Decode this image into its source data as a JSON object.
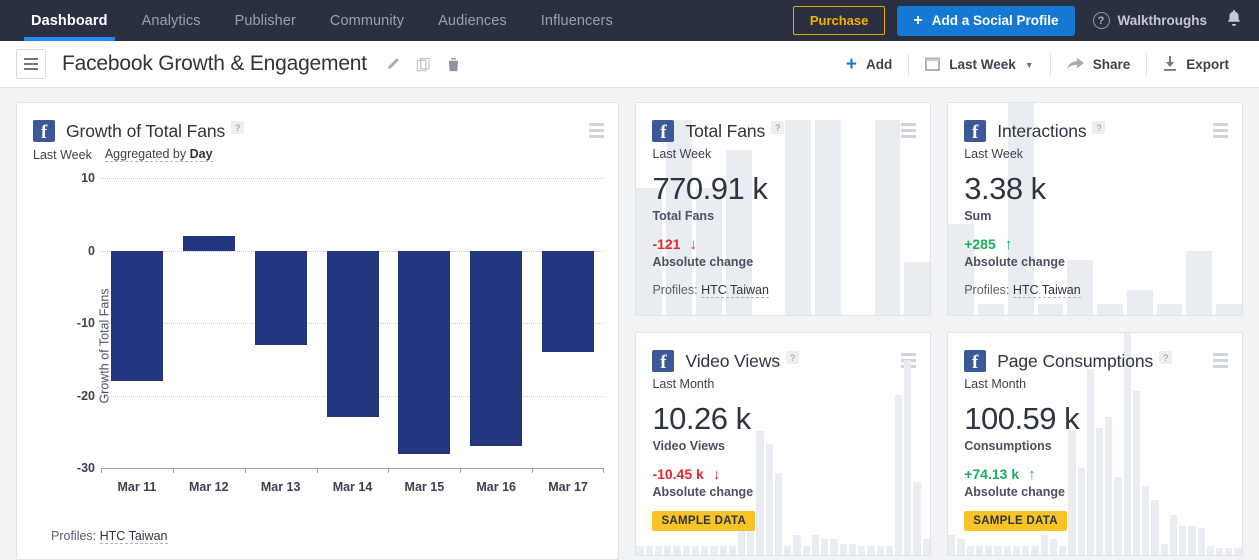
{
  "topnav": {
    "items": [
      {
        "label": "Dashboard",
        "active": true
      },
      {
        "label": "Analytics",
        "active": false
      },
      {
        "label": "Publisher",
        "active": false
      },
      {
        "label": "Community",
        "active": false
      },
      {
        "label": "Audiences",
        "active": false
      },
      {
        "label": "Influencers",
        "active": false
      }
    ],
    "purchase_label": "Purchase",
    "add_profile_label": "Add a Social Profile",
    "add_profile_plus": "+",
    "walkthroughs_label": "Walkthroughs",
    "help_glyph": "?",
    "bell_glyph": "▲",
    "bg_color": "#2b3040",
    "accent_blue": "#1578d3",
    "accent_yellow": "#f5b301"
  },
  "toolbar": {
    "dashboard_title": "Facebook Growth & Engagement",
    "edit_icon": "pencil-icon",
    "copy_icon": "copy-icon",
    "delete_icon": "trash-icon",
    "add_label": "Add",
    "add_plus": "+",
    "date_range_label": "Last Week",
    "share_label": "Share",
    "export_label": "Export"
  },
  "main_chart_card": {
    "title": "Growth of Total Fans",
    "help": "?",
    "period": "Last Week",
    "aggregated_prefix": "Aggregated by ",
    "aggregated_value": "Day",
    "profiles_prefix": "Profiles: ",
    "profiles_value": "HTC Taiwan"
  },
  "chart_data": {
    "type": "bar",
    "title": "Growth of Total Fans",
    "xlabel": "",
    "ylabel": "Growth of Total Fans",
    "categories": [
      "Mar 11",
      "Mar 12",
      "Mar 13",
      "Mar 14",
      "Mar 15",
      "Mar 16",
      "Mar 17"
    ],
    "values": [
      -18,
      2,
      -13,
      -23,
      -28,
      -27,
      -14
    ],
    "ylim": [
      -30,
      10
    ],
    "yticks": [
      10,
      0,
      -10,
      -20,
      -30
    ],
    "grid": true,
    "legend": false,
    "bar_color": "#22357f",
    "aggregation": "Day",
    "period": "Last Week",
    "profiles": "HTC Taiwan"
  },
  "kpi_cards": [
    {
      "title": "Total Fans",
      "help": "?",
      "period": "Last Week",
      "value": "770.91 k",
      "metric_label": "Total Fans",
      "change": "-121",
      "change_arrow": "↓",
      "change_color": "#e8262d",
      "change_label": "Absolute change",
      "profiles_prefix": "Profiles: ",
      "profiles_value": "HTC Taiwan",
      "sample_badge": null,
      "spark": [
        60,
        92,
        60,
        78,
        0,
        92,
        92,
        0,
        92,
        25
      ]
    },
    {
      "title": "Interactions",
      "help": "?",
      "period": "Last Week",
      "value": "3.38 k",
      "metric_label": "Sum",
      "change": "+285",
      "change_arrow": "↑",
      "change_color": "#12b05a",
      "change_label": "Absolute change",
      "profiles_prefix": "Profiles: ",
      "profiles_value": "HTC Taiwan",
      "sample_badge": null,
      "spark": [
        43,
        5,
        100,
        5,
        26,
        5,
        12,
        5,
        30,
        5
      ]
    },
    {
      "title": "Video Views",
      "help": "?",
      "period": "Last Month",
      "value": "10.26 k",
      "metric_label": "Video Views",
      "change": "-10.45 k",
      "change_arrow": "↓",
      "change_color": "#e8262d",
      "change_label": "Absolute change",
      "profiles_prefix": null,
      "profiles_value": null,
      "sample_badge": "SAMPLE DATA",
      "spark": [
        4,
        4,
        4,
        4,
        4,
        4,
        4,
        4,
        4,
        4,
        4,
        20,
        20,
        56,
        50,
        37,
        4,
        9,
        4,
        9,
        7,
        7,
        5,
        5,
        4,
        4,
        4,
        4,
        72,
        88,
        33,
        7
      ]
    },
    {
      "title": "Page Consumptions",
      "help": "?",
      "period": "Last Month",
      "value": "100.59 k",
      "metric_label": "Consumptions",
      "change": "+74.13 k",
      "change_arrow": "↑",
      "change_color": "#12b05a",
      "change_label": "Absolute change",
      "profiles_prefix": null,
      "profiles_value": null,
      "sample_badge": "SAMPLE DATA",
      "spark": [
        9,
        7,
        4,
        4,
        4,
        4,
        4,
        4,
        4,
        4,
        9,
        7,
        4,
        56,
        39,
        84,
        57,
        62,
        35,
        100,
        74,
        31,
        25,
        5,
        18,
        13,
        13,
        12,
        4,
        3,
        3,
        3
      ]
    }
  ]
}
